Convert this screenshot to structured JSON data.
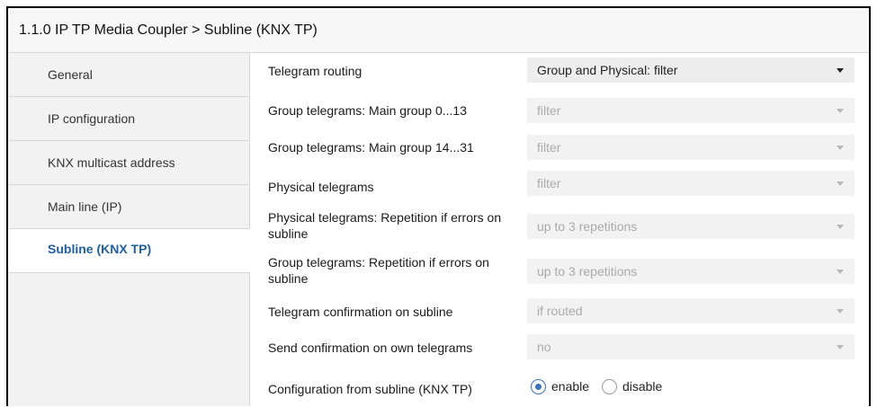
{
  "header": {
    "title": "1.1.0 IP TP Media Coupler > Subline (KNX TP)"
  },
  "sidebar": {
    "items": [
      {
        "label": "General"
      },
      {
        "label": "IP configuration"
      },
      {
        "label": "KNX multicast address"
      },
      {
        "label": "Main line (IP)"
      },
      {
        "label": "Subline (KNX TP)",
        "active": true
      }
    ]
  },
  "params": [
    {
      "label": "Telegram routing",
      "value": "Group and Physical: filter",
      "enabled": true
    },
    {
      "label": "Group telegrams: Main group 0...13",
      "value": "filter",
      "enabled": false
    },
    {
      "label": "Group telegrams: Main group 14...31",
      "value": "filter",
      "enabled": false
    },
    {
      "label": "Physical telegrams",
      "value": "filter",
      "enabled": false
    },
    {
      "label": "Physical telegrams: Repetition if errors on subline",
      "value": "up to 3 repetitions",
      "enabled": false
    },
    {
      "label": "Group telegrams: Repetition if errors on subline",
      "value": "up to 3 repetitions",
      "enabled": false
    },
    {
      "label": "Telegram confirmation on subline",
      "value": "if routed",
      "enabled": false
    },
    {
      "label": "Send confirmation on own telegrams",
      "value": "no",
      "enabled": false
    },
    {
      "label": "Configuration from subline (KNX TP)",
      "options": [
        "enable",
        "disable"
      ],
      "selected": "enable"
    }
  ],
  "colors": {
    "accent": "#1f5f9f",
    "radio_selected": "#3b72b8"
  }
}
